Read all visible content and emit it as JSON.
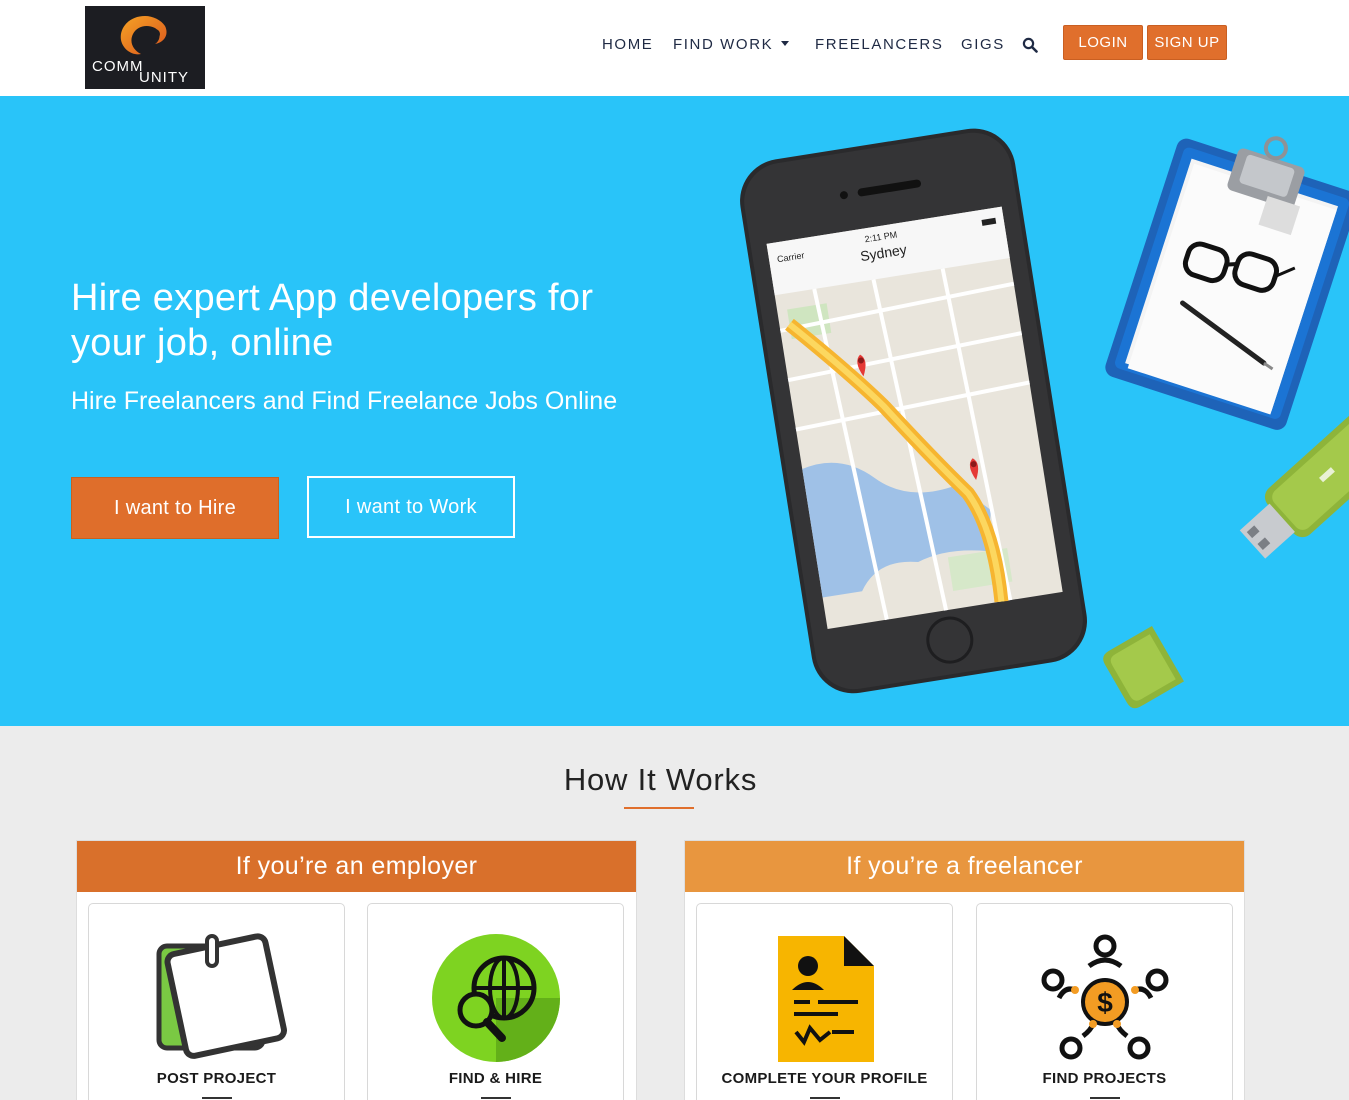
{
  "logo": {
    "line1": "COMM",
    "line2": "UNITY"
  },
  "nav": {
    "home": "HOME",
    "find_work": "FIND WORK",
    "freelancers": "FREELANCERS",
    "gigs": "GIGS",
    "search_icon": "search-icon"
  },
  "auth": {
    "login": "LOGIN",
    "signup": "SIGN UP"
  },
  "hero": {
    "title": "Hire expert App developers for your job, online",
    "subtitle": "Hire Freelancers and Find Freelance Jobs Online",
    "hire_button": "I want to Hire",
    "work_button": "I want to Work",
    "phone": {
      "carrier": "Carrier",
      "time": "2:11 PM",
      "city": "Sydney"
    }
  },
  "how_it_works": {
    "title": "How It Works",
    "employer": {
      "heading": "If you’re an employer",
      "cards": [
        {
          "label": "POST PROJECT",
          "icon": "sticky-note-icon"
        },
        {
          "label": "FIND & HIRE",
          "icon": "globe-search-icon"
        }
      ]
    },
    "freelancer": {
      "heading": "If you’re a freelancer",
      "cards": [
        {
          "label": "COMPLETE YOUR PROFILE",
          "icon": "profile-document-icon"
        },
        {
          "label": "FIND PROJECTS",
          "icon": "people-money-icon"
        }
      ]
    }
  },
  "colors": {
    "brand_orange": "#e06f2c",
    "freelancer_orange": "#e8963f",
    "hero_blue": "#29c4f9"
  }
}
